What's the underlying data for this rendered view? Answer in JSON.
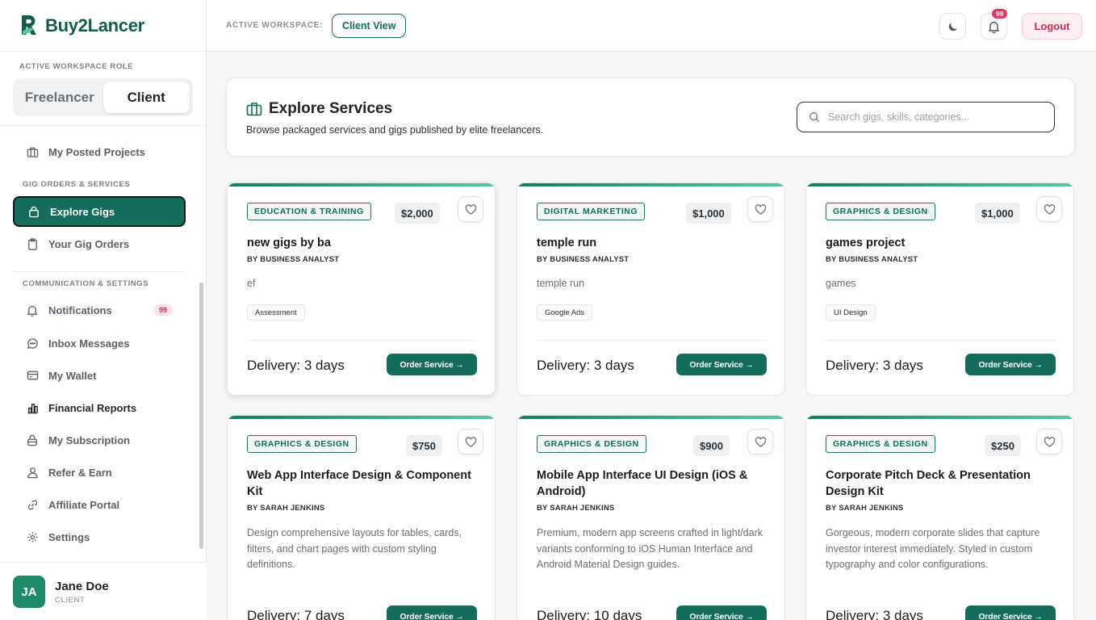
{
  "brand": {
    "name": "Buy2Lancer"
  },
  "sidebar": {
    "role_label": "ACTIVE WORKSPACE ROLE",
    "roles": [
      "Freelancer",
      "Client"
    ],
    "active_role": "Client",
    "top_items": [
      {
        "label": "My Posted Projects",
        "icon": "briefcase-icon"
      }
    ],
    "section_gig": "GIG ORDERS & SERVICES",
    "gig_items": [
      {
        "label": "Explore Gigs",
        "icon": "bag-icon",
        "active": true
      },
      {
        "label": "Your Gig Orders",
        "icon": "clipboard-icon"
      }
    ],
    "section_comm": "COMMUNICATION & SETTINGS",
    "comm_items": [
      {
        "label": "Notifications",
        "icon": "bell-icon",
        "badge": "99"
      },
      {
        "label": "Inbox Messages",
        "icon": "chat-icon"
      },
      {
        "label": "My Wallet",
        "icon": "wallet-icon"
      },
      {
        "label": "Financial Reports",
        "icon": "chart-icon"
      },
      {
        "label": "My Subscription",
        "icon": "lock-icon"
      },
      {
        "label": "Refer & Earn",
        "icon": "users-icon"
      },
      {
        "label": "Affiliate Portal",
        "icon": "link-icon"
      },
      {
        "label": "Settings",
        "icon": "gear-icon"
      }
    ],
    "user": {
      "initials": "JA",
      "name": "Jane Doe",
      "role": "CLIENT"
    }
  },
  "header": {
    "workspace_label": "ACTIVE WORKSPACE:",
    "workspace_button": "Client View",
    "notification_count": "99",
    "logout_label": "Logout"
  },
  "explore": {
    "title": "Explore Services",
    "subtitle": "Browse packaged services and gigs published by elite freelancers.",
    "search_placeholder": "Search gigs, skills, categories..."
  },
  "gigs": [
    {
      "category": "EDUCATION & TRAINING",
      "price": "$2,000",
      "title": "new gigs by ba",
      "author": "BY BUSINESS ANALYST",
      "description": "ef",
      "tag": "Assessment",
      "delivery": "Delivery: 3 days",
      "order_label": "Order Service →"
    },
    {
      "category": "DIGITAL MARKETING",
      "price": "$1,000",
      "title": "temple run",
      "author": "BY BUSINESS ANALYST",
      "description": "temple run",
      "tag": "Google Ads",
      "delivery": "Delivery: 3 days",
      "order_label": "Order Service →"
    },
    {
      "category": "GRAPHICS & DESIGN",
      "price": "$1,000",
      "title": "games project",
      "author": "BY BUSINESS ANALYST",
      "description": "games",
      "tag": "UI Design",
      "delivery": "Delivery: 3 days",
      "order_label": "Order Service →"
    },
    {
      "category": "GRAPHICS & DESIGN",
      "price": "$750",
      "title": "Web App Interface Design & Component Kit",
      "author": "BY SARAH JENKINS",
      "description": "Design comprehensive layouts for tables, cards, filters, and chart pages with custom styling definitions.",
      "delivery": "Delivery: 7 days",
      "order_label": "Order Service →"
    },
    {
      "category": "GRAPHICS & DESIGN",
      "price": "$900",
      "title": "Mobile App Interface UI Design (iOS & Android)",
      "author": "BY SARAH JENKINS",
      "description": "Premium, modern app screens crafted in light/dark variants conforming to iOS Human Interface and Android Material Design guides.",
      "delivery": "Delivery: 10 days",
      "order_label": "Order Service →"
    },
    {
      "category": "GRAPHICS & DESIGN",
      "price": "$250",
      "title": "Corporate Pitch Deck & Presentation Design Kit",
      "author": "BY SARAH JENKINS",
      "description": "Gorgeous, modern corporate slides that capture investor interest immediately. Styled in custom typography and color configurations.",
      "delivery": "Delivery: 3 days",
      "order_label": "Order Service →"
    }
  ],
  "colors": {
    "brand": "#146c5c",
    "accent_red": "#d22a54"
  }
}
